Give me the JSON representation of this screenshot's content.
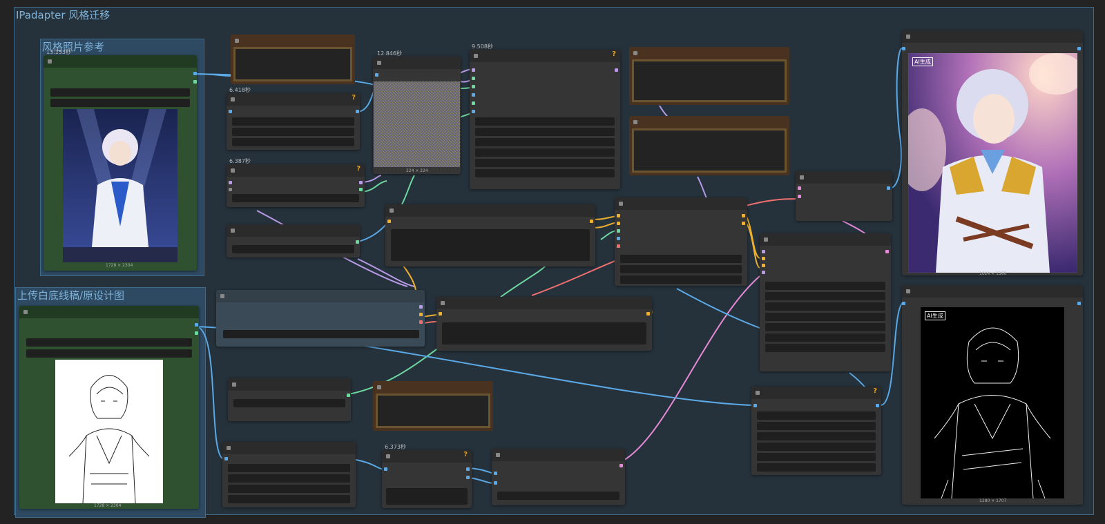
{
  "groups": {
    "main_title": "IPadapter 风格迁移",
    "style_ref_title": "风格照片参考",
    "upload_title": "上传白底线稿/原设计图"
  },
  "timings": {
    "t1": "13.153秒",
    "t2": "6.418秒",
    "t3": "12.846秒",
    "t4": "9.508秒",
    "t5": "6.387秒",
    "t6": "6.373秒"
  },
  "images": {
    "style_photo_size": "1728 × 2304",
    "noise_size": "224 × 224",
    "lineart_size": "1728 × 2304",
    "output_color_size": "1024 × 1360",
    "output_lineart_size": "1280 × 1707"
  },
  "watermarks": {
    "ai_generated": "AI生成"
  },
  "icons": {
    "node_collapse": "node-collapse-icon",
    "node_warning": "question-mark-icon"
  },
  "node_warning_mark": "?",
  "colors": {
    "canvas": "#232323",
    "group_border": "#3f6a8a",
    "group_title": "#7fb2d8",
    "wire_blue": "#5ba9e6",
    "wire_purple": "#b89ae6",
    "wire_green": "#6ed8a0",
    "wire_orange": "#f0b030",
    "wire_red": "#f07070",
    "wire_pink": "#e68ad8"
  }
}
